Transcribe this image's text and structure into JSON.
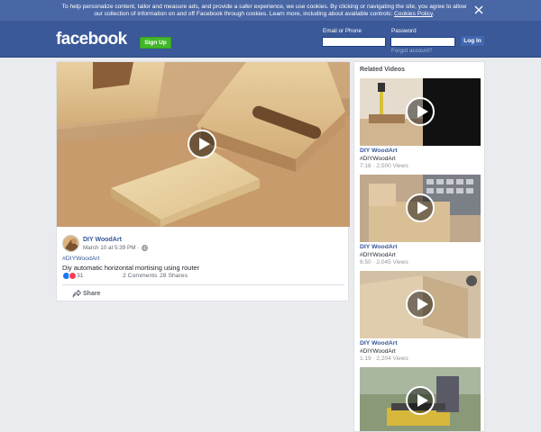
{
  "cookie_banner": {
    "text_line1": "To help personalize content, tailor and measure ads, and provide a safer experience, we use cookies. By clicking or navigating the site, you agree to allow",
    "text_line2": "our collection of information on and off Facebook through cookies. Learn more, including about available controls: ",
    "link": "Cookies Policy",
    "link_suffix": "."
  },
  "header": {
    "logo": "facebook",
    "signup_label": "Sign Up",
    "email_label": "Email or Phone",
    "email_value": "",
    "password_label": "Password",
    "password_value": "",
    "login_label": "Log In",
    "forgot_label": "Forgot account?"
  },
  "post": {
    "page_name": "DIY WoodArt",
    "time": "March 10 at 5:39 PM · ",
    "hashtag": "#DIYWoodArt",
    "text": "Diy automatic horizontal mortising using router",
    "reaction_count": "31",
    "comments": "2 Comments",
    "shares": "28 Shares",
    "share_label": "Share"
  },
  "related": {
    "title": "Related Videos",
    "videos": [
      {
        "name": "DIY WoodArt",
        "tag": "#DIYWoodArt",
        "meta": "7:18 · 2,500 Views"
      },
      {
        "name": "DIY WoodArt",
        "tag": "#DIYWoodArt",
        "meta": "6:50 · 2,045 Views"
      },
      {
        "name": "DIY WoodArt",
        "tag": "#DIYWoodArt",
        "meta": "1:19 · 2,204 Views"
      },
      {
        "name": "",
        "tag": "",
        "meta": ""
      }
    ]
  },
  "colors": {
    "brand_blue": "#3b5998",
    "banner_blue": "#4a67a5",
    "signup_green": "#42b72a",
    "link_blue": "#365899"
  }
}
